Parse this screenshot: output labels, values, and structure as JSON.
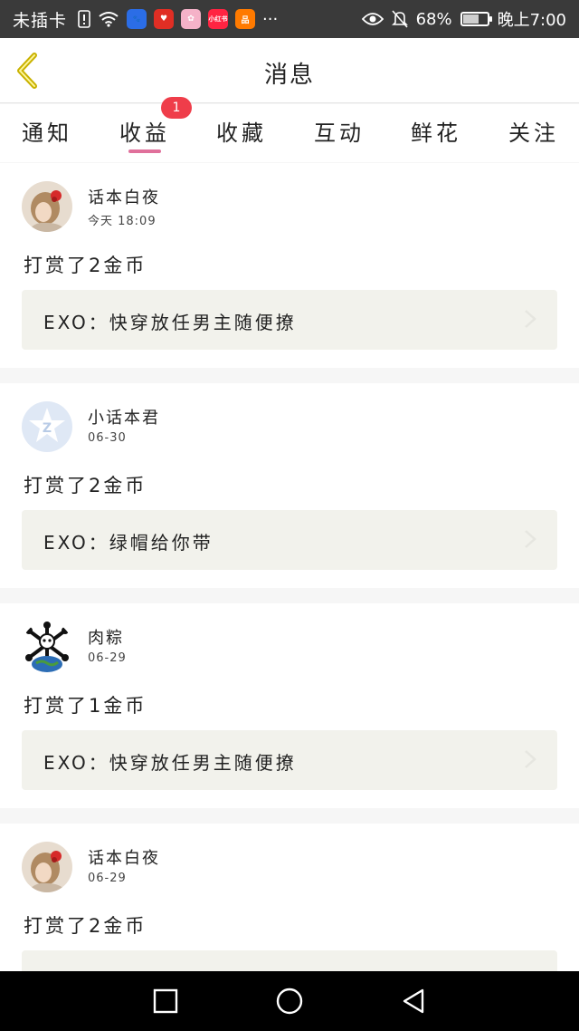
{
  "status_bar": {
    "carrier": "未插卡",
    "battery_percent": "68%",
    "battery_level": 0.68,
    "time": "晚上7:00",
    "app_icons": [
      {
        "name": "baidu-app-icon",
        "color": "#2b6de6",
        "text": "🐾"
      },
      {
        "name": "pinduoduo-app-icon",
        "color": "#e02e24",
        "text": "♥"
      },
      {
        "name": "photos-app-icon",
        "color": "#f5b2c8",
        "text": "✿"
      },
      {
        "name": "xiaohongshu-app-icon",
        "color": "#ff2442",
        "text": "小红书"
      },
      {
        "name": "taobao-app-icon",
        "color": "#ff7a00",
        "text": "品"
      }
    ],
    "more": "···"
  },
  "header": {
    "title": "消息"
  },
  "tabs": {
    "items": [
      {
        "label": "通知"
      },
      {
        "label": "收益",
        "active": true
      },
      {
        "label": "收藏"
      },
      {
        "label": "互动"
      },
      {
        "label": "鲜花"
      },
      {
        "label": "关注"
      }
    ],
    "badge": "1",
    "accent_color": "#e0709b"
  },
  "feed": [
    {
      "avatar": "girl-avatar",
      "username": "话本白夜",
      "time": "今天 18:09",
      "action": "打赏了2金币",
      "book": "EXO：快穿放任男主随便撩"
    },
    {
      "avatar": "star-avatar",
      "username": "小话本君",
      "time": "06-30",
      "action": "打赏了2金币",
      "book": "EXO：绿帽给你带"
    },
    {
      "avatar": "skull-earth-avatar",
      "username": "肉粽",
      "time": "06-29",
      "action": "打赏了1金币",
      "book": "EXO：快穿放任男主随便撩"
    },
    {
      "avatar": "girl-avatar",
      "username": "话本白夜",
      "time": "06-29",
      "action": "打赏了2金币",
      "book": ""
    }
  ]
}
